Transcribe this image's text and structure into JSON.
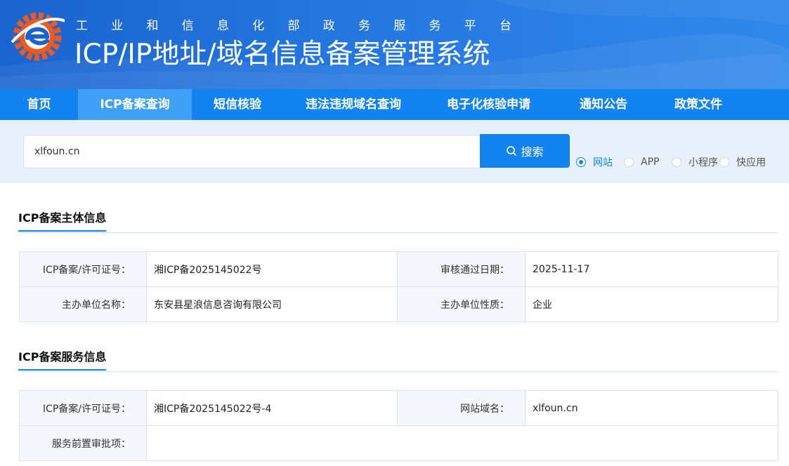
{
  "header": {
    "subtitle_chars": [
      "工",
      "业",
      "和",
      "信",
      "息",
      "化",
      "部",
      "政",
      "务",
      "服",
      "务",
      "平",
      "台"
    ],
    "title": "ICP/IP地址/域名信息备案管理系统"
  },
  "nav": {
    "items": [
      {
        "label": "首页"
      },
      {
        "label": "ICP备案查询"
      },
      {
        "label": "短信核验"
      },
      {
        "label": "违法违规域名查询"
      },
      {
        "label": "电子化核验申请"
      },
      {
        "label": "通知公告"
      },
      {
        "label": "政策文件"
      }
    ],
    "active_index": 1
  },
  "search": {
    "value": "xlfoun.cn",
    "button_label": "搜索",
    "options": [
      {
        "label": "网站",
        "checked": true
      },
      {
        "label": "APP",
        "checked": false
      },
      {
        "label": "小程序",
        "checked": false
      },
      {
        "label": "快应用",
        "checked": false
      }
    ]
  },
  "entity_section": {
    "title": "ICP备案主体信息",
    "rows": [
      {
        "label1": "ICP备案/许可证号：",
        "value1": "湘ICP备2025145022号",
        "label2": "审核通过日期：",
        "value2": "2025-11-17"
      },
      {
        "label1": "主办单位名称：",
        "value1": "东安县星浪信息咨询有限公司",
        "label2": "主办单位性质：",
        "value2": "企业"
      }
    ]
  },
  "service_section": {
    "title": "ICP备案服务信息",
    "rows": [
      {
        "label1": "ICP备案/许可证号：",
        "value1": "湘ICP备2025145022号-4",
        "label2": "网站域名：",
        "value2": "xlfoun.cn"
      },
      {
        "label1": "服务前置审批项：",
        "value1": ""
      }
    ]
  },
  "colors": {
    "primary": "#1383f0",
    "nav_active": "#3fa0f5",
    "search_band": "#e6f1fc",
    "logo_orange": "#f05a1e"
  }
}
